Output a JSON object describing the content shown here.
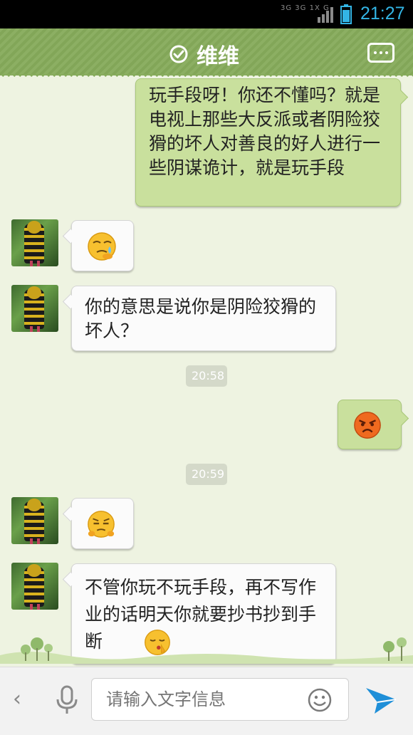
{
  "status_bar": {
    "network_top": "3G 3G 1X G",
    "time": "21:27",
    "color": "#33b5e5"
  },
  "header": {
    "title": "维维",
    "bg_color": "#86ab5b",
    "status_icon": "check-circle-icon",
    "more_icon": "more-dots-icon"
  },
  "messages": [
    {
      "side": "right",
      "type": "text",
      "text": "玩手段呀！你还不懂吗？就是电视上那些大反派或者阴险狡猾的坏人对善良的好人进行一些阴谋诡计，就是玩手段"
    },
    {
      "side": "left",
      "type": "emoji",
      "emoji": "crying-sweat-emoji"
    },
    {
      "side": "left",
      "type": "text",
      "text": "你的意思是说你是阴险狡猾的坏人？"
    },
    {
      "type": "time",
      "text": "20:58"
    },
    {
      "side": "right",
      "type": "emoji",
      "emoji": "angry-face-emoji"
    },
    {
      "type": "time",
      "text": "20:59"
    },
    {
      "side": "left",
      "type": "emoji",
      "emoji": "smug-face-emoji"
    },
    {
      "side": "left",
      "type": "text",
      "text": "不管你玩不玩手段，再不写作业的话明天你就要抄书抄到手断",
      "emoji": "shush-emoji"
    }
  ],
  "input_bar": {
    "placeholder": "请输入文字信息",
    "back_icon": "chevron-left-icon",
    "voice_icon": "microphone-icon",
    "emoji_icon": "smiley-icon",
    "send_icon": "send-icon"
  },
  "colors": {
    "chat_bg": "#eef3e1",
    "my_bubble": "#c9e09d",
    "their_bubble": "#fbfbfb",
    "accent_blue": "#1f8fd8"
  }
}
